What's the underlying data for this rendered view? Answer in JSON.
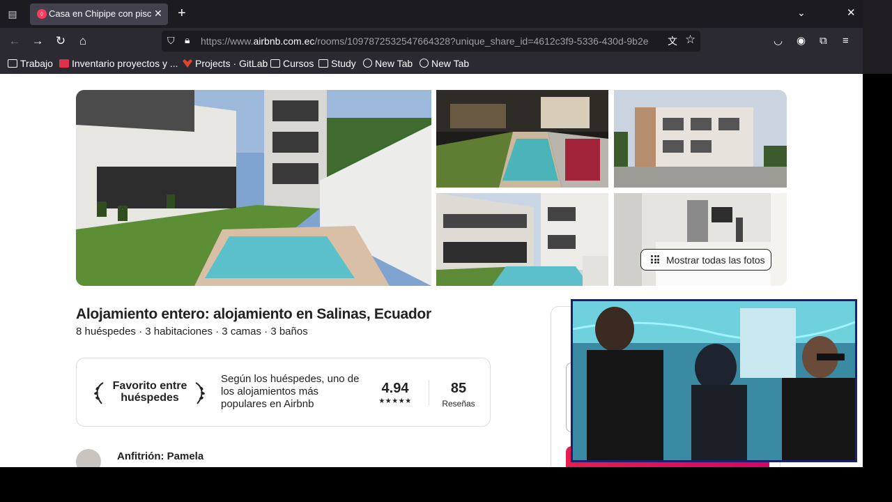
{
  "browser": {
    "tab": {
      "title": "Casa en Chipipe con piscina"
    },
    "url": {
      "prefix": "https://www.",
      "domain": "airbnb.com.ec",
      "path": "/rooms/1097872532547664328?unique_share_id=4612c3f9-5336-430d-9b2e"
    },
    "bookmarks": [
      {
        "label": "Trabajo",
        "icon": "folder-icon"
      },
      {
        "label": "Inventario proyectos y ...",
        "icon": "sheet-icon"
      },
      {
        "label": "Projects · GitLab",
        "icon": "gitlab-icon"
      },
      {
        "label": "Cursos",
        "icon": "folder-icon"
      },
      {
        "label": "Study",
        "icon": "folder-icon"
      },
      {
        "label": "New Tab",
        "icon": "globe-icon"
      },
      {
        "label": "New Tab",
        "icon": "globe-icon"
      }
    ]
  },
  "listing": {
    "show_all_photos": "Mostrar todas las fotos",
    "title": "Alojamiento entero: alojamiento en Salinas, Ecuador",
    "summary": "8 huéspedes · 3 habitaciones · 3 camas · 3 baños",
    "favorite": {
      "label": "Favorito entre huéspedes",
      "description": "Según los huéspedes, uno de los alojamientos más populares en Airbnb",
      "rating": "4.94",
      "stars": "★★★★★",
      "reviews_count": "85",
      "reviews_label": "Reseñas"
    },
    "host": "Anfitrión: Pamela"
  },
  "colors": {
    "brand": "#ff385c",
    "chrome_dark": "#1c1b22",
    "chrome": "#2b2a33",
    "text": "#222222"
  }
}
